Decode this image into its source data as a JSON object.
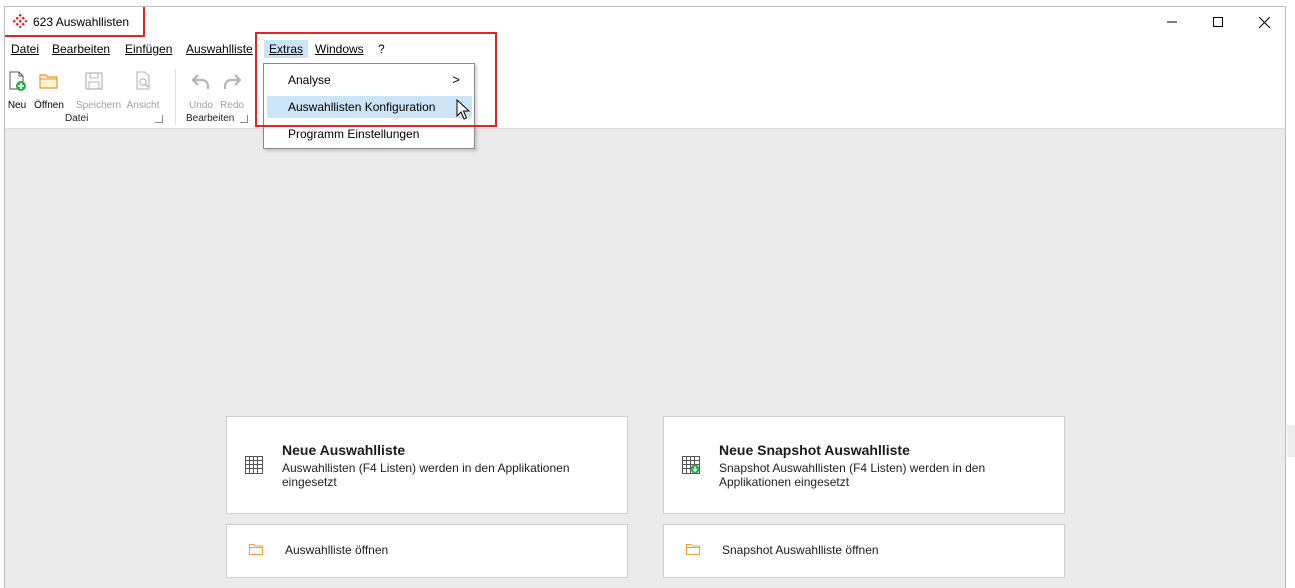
{
  "window": {
    "title": "623 Auswahllisten",
    "controls": {
      "minimize": "minimize-icon",
      "maximize": "maximize-icon",
      "close": "close-icon"
    }
  },
  "menubar": {
    "items": [
      {
        "label": "Datei",
        "key": "D"
      },
      {
        "label": "Bearbeiten",
        "key": "B"
      },
      {
        "label": "Einfügen",
        "key": "E"
      },
      {
        "label": "Auswahlliste",
        "key": "A"
      },
      {
        "label": "Extras",
        "key": "x"
      },
      {
        "label": "Windows",
        "key": "W"
      },
      {
        "label": "?",
        "key": ""
      }
    ]
  },
  "ribbon": {
    "groups": [
      {
        "label": "Datei",
        "buttons": [
          {
            "label": "Neu",
            "icon": "new-file-icon",
            "enabled": true
          },
          {
            "label": "Öffnen",
            "icon": "folder-icon",
            "enabled": true
          },
          {
            "label": "Speichern",
            "icon": "save-icon",
            "enabled": false
          },
          {
            "label": "Ansicht",
            "icon": "preview-icon",
            "enabled": false
          }
        ]
      },
      {
        "label": "Bearbeiten",
        "buttons": [
          {
            "label": "Undo",
            "icon": "undo-icon",
            "enabled": false
          },
          {
            "label": "Redo",
            "icon": "redo-icon",
            "enabled": false
          }
        ]
      }
    ]
  },
  "extras_menu": {
    "items": [
      {
        "label": "Analyse",
        "has_submenu": true,
        "hovered": false
      },
      {
        "label": "Auswahllisten Konfiguration",
        "has_submenu": false,
        "hovered": true
      },
      {
        "label": "Programm Einstellungen",
        "has_submenu": false,
        "hovered": false
      }
    ]
  },
  "cards": {
    "new_list": {
      "title": "Neue Auswahlliste",
      "description": "Auswahllisten (F4 Listen) werden in den Applikationen eingesetzt",
      "icon": "grid-icon"
    },
    "new_snapshot": {
      "title": "Neue Snapshot Auswahlliste",
      "description": "Snapshot Auswahllisten (F4 Listen) werden in den Applikationen eingesetzt",
      "icon": "grid-snapshot-icon"
    },
    "open_list": {
      "label": "Auswahlliste öffnen",
      "icon": "folder-icon"
    },
    "open_snapshot": {
      "label": "Snapshot Auswahlliste öffnen",
      "icon": "folder-icon"
    }
  },
  "colors": {
    "highlight_red": "#e0242a",
    "menu_hover": "#cce4f7",
    "content_bg": "#ebebeb",
    "folder_orange": "#f0a040"
  }
}
